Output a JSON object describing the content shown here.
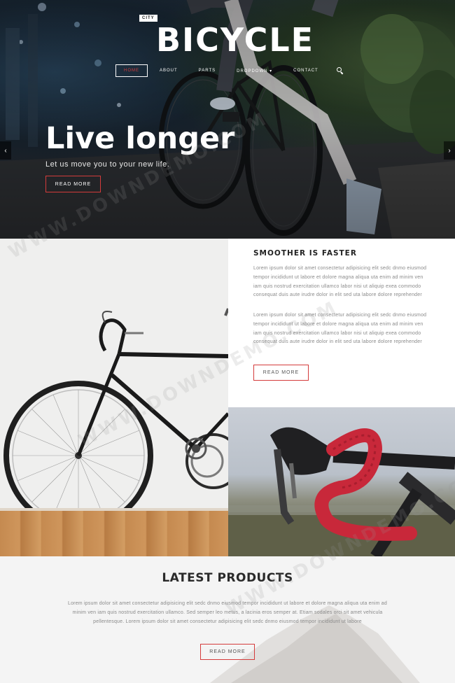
{
  "header": {
    "brand_small": "CITY",
    "brand_big": "BICYCLE",
    "nav": [
      {
        "label": "HOME"
      },
      {
        "label": "ABOUT"
      },
      {
        "label": "PARTS"
      },
      {
        "label": "DROPDOWN"
      },
      {
        "label": "CONTACT"
      }
    ],
    "dropdown_caret": "▾"
  },
  "hero": {
    "title": "Live longer",
    "subtitle": "Let us move you to your new life.",
    "button": "READ MORE",
    "arrow_left": "‹",
    "arrow_right": "›"
  },
  "feature": {
    "title": "SMOOTHER IS FASTER",
    "paragraph1": "Lorem ipsum dolor sit amet consectetur adipisicing elit sedc dnmo eiusmod tempor incididunt ut labore et dolore magna aliqua uta enim ad minim ven iam quis nostrud exercitation ullamco labor nisi ut aliquip exea commodo consequat duis aute irudre dolor in elit sed uta labore dolore reprehender",
    "paragraph2": "Lorem ipsum dolor sit amet consectetur adipisicing elit sedc dnmo eiusmod tempor incididunt ut labore et dolore magna aliqua uta enim ad minim ven iam quis nostrud exercitation ullamco labor nisi ut aliquip exea commodo consequat duis aute irudre dolor in elit sed uta labore dolore reprehender",
    "button": "READ MORE"
  },
  "products": {
    "title": "LATEST PRODUCTS",
    "paragraph": "Lorem ipsum dolor sit amet consectetur adipisicing elit sedc dnmo eiusmod tempor incididunt ut labore et dolore magna aliqua uta enim ad minim ven iam quis nostrud exercitation ullamco. Sed semper leo metus, a lacinia eros semper at. Etiam sodales orci sit amet vehicula pellentesque. Lorem ipsum dolor sit amet consectetur adipisicing elit sedc dnmo eiusmod tempor incididunt ut labore",
    "button": "READ MORE"
  },
  "watermark": "WWW.DOWNDEMO.COM",
  "colors": {
    "accent": "#d43b3b",
    "hero_dark": "#1e2831",
    "text_gray": "#8a8a8a",
    "floor_wood": "#c58a50",
    "bar_tape_red": "#c8283a"
  },
  "icons": [
    "search-icon",
    "chevron-left-icon",
    "chevron-right-icon",
    "caret-down-icon"
  ]
}
